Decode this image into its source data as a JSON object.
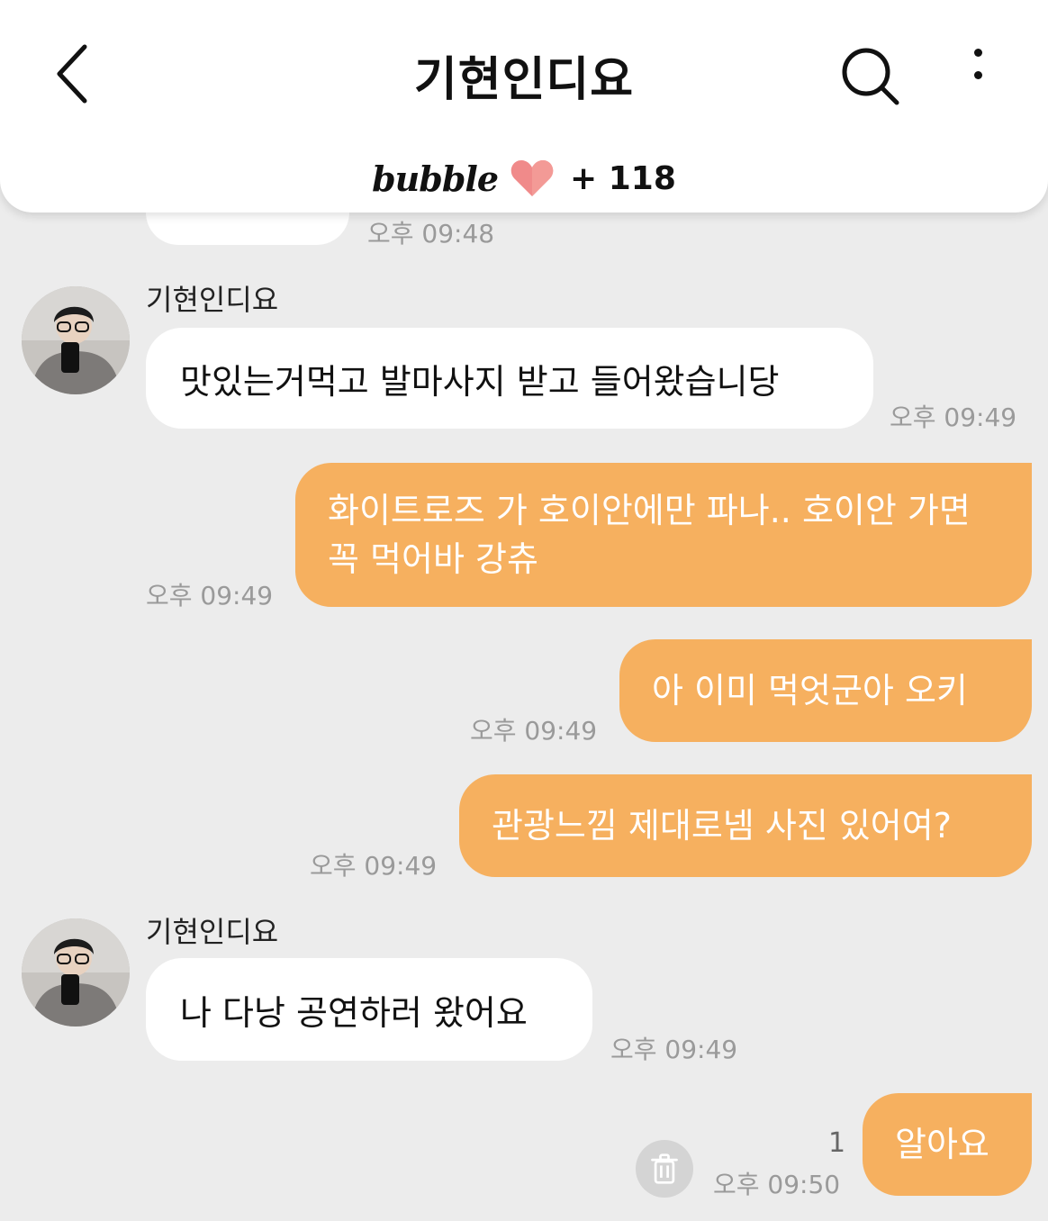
{
  "header": {
    "title": "기현인디요",
    "brand": "bubble",
    "heart_count": "+ 118"
  },
  "icons": {
    "back": "chevron-left-icon",
    "search": "search-icon",
    "more": "more-vertical-icon",
    "heart": "heart-icon",
    "trash": "trash-icon"
  },
  "colors": {
    "outgoing_bubble": "#f6b05f",
    "incoming_bubble": "#ffffff",
    "background": "#ececec",
    "heart": "#f08a8a"
  },
  "messages": [
    {
      "direction": "in",
      "text": "",
      "time": "오후 09:48"
    },
    {
      "direction": "in",
      "sender": "기현인디요",
      "text": "맛있는거먹고 발마사지 받고 들어왔습니당",
      "time": "오후 09:49"
    },
    {
      "direction": "out",
      "text": "화이트로즈 가 호이안에만 파나.. 호이안 가면 꼭 먹어바 강츄",
      "time": "오후 09:49"
    },
    {
      "direction": "out",
      "text": "아 이미 먹엇군아 오키",
      "time": "오후 09:49"
    },
    {
      "direction": "out",
      "text": "관광느낌 제대로넴 사진 있어여?",
      "time": "오후 09:49"
    },
    {
      "direction": "in",
      "sender": "기현인디요",
      "text": "나 다낭 공연하러 왔어요",
      "time": "오후 09:49"
    },
    {
      "direction": "out",
      "text": "알아요",
      "time": "오후 09:50",
      "unread": "1"
    }
  ]
}
